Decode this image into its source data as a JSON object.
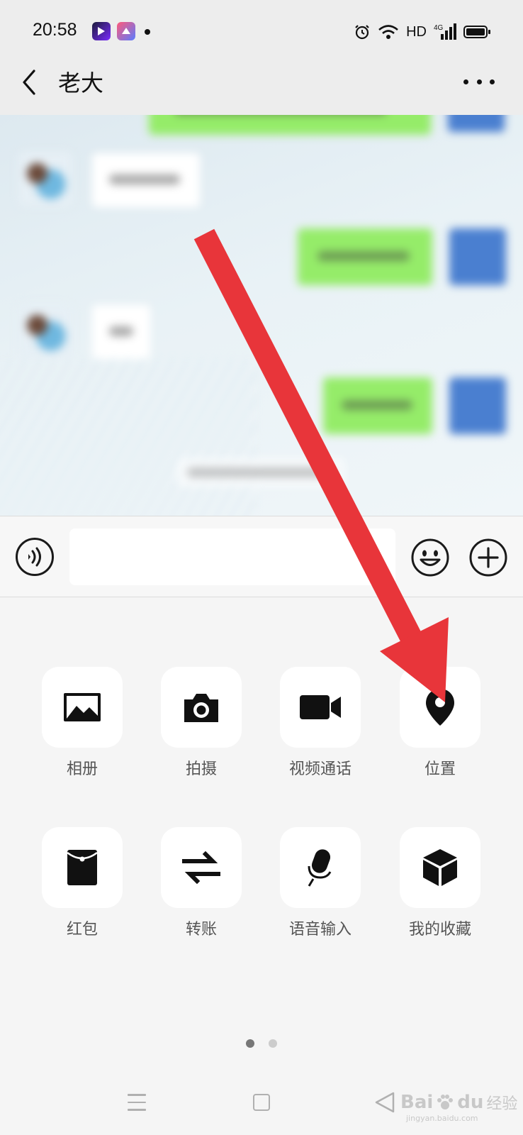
{
  "status_bar": {
    "time": "20:58",
    "network_label": "HD",
    "network_type": "4G",
    "icons": [
      "video-app-icon",
      "gallery-app-icon",
      "alarm-icon",
      "wifi-icon",
      "signal-icon",
      "battery-icon"
    ]
  },
  "title_bar": {
    "title": "老大",
    "back_icon": "chevron-left-icon",
    "more_icon": "more-dots-icon"
  },
  "chat": {
    "background_color": "#e6f0f5",
    "sent_bubble_color": "#95ec69",
    "received_bubble_color": "#ffffff"
  },
  "input_bar": {
    "voice_icon": "voice-icon",
    "input_value": "",
    "emoji_icon": "emoji-icon",
    "plus_icon": "plus-icon"
  },
  "actions": [
    {
      "label": "相册",
      "icon": "photo-album-icon"
    },
    {
      "label": "拍摄",
      "icon": "camera-icon"
    },
    {
      "label": "视频通话",
      "icon": "video-call-icon"
    },
    {
      "label": "位置",
      "icon": "location-pin-icon"
    },
    {
      "label": "红包",
      "icon": "red-packet-icon"
    },
    {
      "label": "转账",
      "icon": "transfer-icon"
    },
    {
      "label": "语音输入",
      "icon": "microphone-icon"
    },
    {
      "label": "我的收藏",
      "icon": "favorites-cube-icon"
    }
  ],
  "pagination": {
    "current": 1,
    "total": 2,
    "active_color": "#777777",
    "inactive_color": "#cccccc"
  },
  "annotation": {
    "arrow_color": "#e8353a"
  },
  "watermark": {
    "brand": "Bai",
    "brand_suffix": "du",
    "brand_cn": "经验",
    "url": "jingyan.baidu.com"
  }
}
